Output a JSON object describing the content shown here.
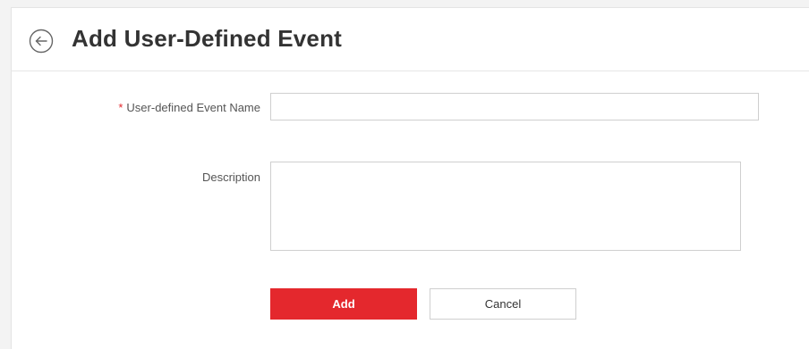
{
  "header": {
    "title": "Add User-Defined Event",
    "back_icon": "back-arrow-circle-icon"
  },
  "form": {
    "name_field": {
      "required_marker": "*",
      "label": "User-defined Event Name",
      "value": "",
      "placeholder": ""
    },
    "description_field": {
      "label": "Description",
      "value": "",
      "placeholder": ""
    }
  },
  "actions": {
    "add_label": "Add",
    "cancel_label": "Cancel"
  },
  "colors": {
    "accent": "#e4282d",
    "title_text": "#333333",
    "label_text": "#555555",
    "border": "#cfcfcf"
  }
}
